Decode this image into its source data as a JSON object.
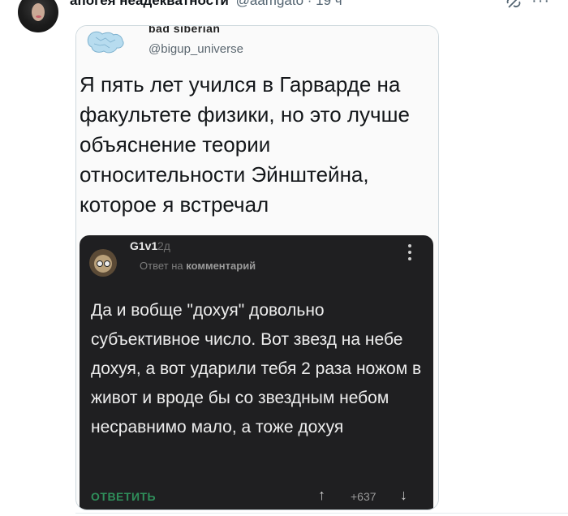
{
  "tweet": {
    "author_name": "апогея неадекватности",
    "author_handle": "@aamgato · 19 ч"
  },
  "embedded": {
    "cut_name": "bad siberian",
    "handle": "@bigup_universe",
    "text": "Я пять лет учился в Гарварде на факультете физики, но это лучше объяснение теории относительности Эйнштейна, которое я встречал"
  },
  "comment": {
    "username": "G1v1",
    "age": "2д",
    "meta_prefix": "Ответ на",
    "meta_target": "комментарий",
    "text": "Да и вобще \"дохуя\" довольно субъективное число. Вот звезд на небе дохуя, а вот ударили тебя 2 раза ножом в живот и вроде бы со звездным небом несравнимо мало, а тоже дохуя",
    "reply_label": "ОТВЕТИТЬ",
    "votes": "+637",
    "colors": {
      "background": "#1f1f21",
      "reply_accent": "#2f8f5b"
    }
  },
  "icons": {
    "grok": "grok-icon",
    "more": "more-icon",
    "kebab": "kebab-icon",
    "upvote": "arrow-up-icon",
    "downvote": "arrow-down-icon"
  }
}
